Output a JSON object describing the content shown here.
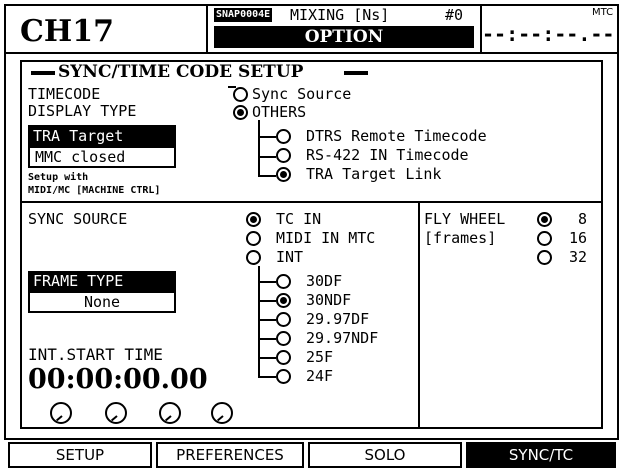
{
  "header": {
    "channel": "CH17",
    "snap_badge": "SNAP0004E",
    "mode": "MIXING [Ns]",
    "hash": "#0",
    "screen": "OPTION",
    "mtc_label": "MTC",
    "mtc_value": "--:--:--.--"
  },
  "panel": {
    "title": "SYNC/TIME CODE SETUP",
    "timecode_label_1": "TIMECODE",
    "timecode_label_2": "DISPLAY TYPE",
    "display_options": {
      "sync_source": "Sync Source",
      "others": "OTHERS",
      "dtrs": "DTRS Remote Timecode",
      "rs422": "RS-422 IN Timecode",
      "tra": "TRA Target Link"
    },
    "tra_target": "TRA Target",
    "mmc": "MMC closed",
    "setup_with_1": "Setup with",
    "setup_with_2": "MIDI/MC [MACHINE CTRL]",
    "sync_source_label": "SYNC SOURCE",
    "sync_options": {
      "tc_in": "TC IN",
      "midi_mtc": "MIDI IN MTC",
      "int": "INT"
    },
    "frame_rates": [
      "30DF",
      "30NDF",
      "29.97DF",
      "29.97NDF",
      "25F",
      "24F"
    ],
    "frame_type_label": "FRAME TYPE",
    "frame_type_value": "None",
    "int_start_label": "INT.START TIME",
    "int_start_value": "00:00:00.00",
    "fly_wheel_label": "FLY WHEEL",
    "fly_wheel_unit": "[frames]",
    "fly_wheel_values": [
      "8",
      "16",
      "32"
    ]
  },
  "tabs": [
    "SETUP",
    "PREFERENCES",
    "SOLO",
    "SYNC/TC"
  ]
}
